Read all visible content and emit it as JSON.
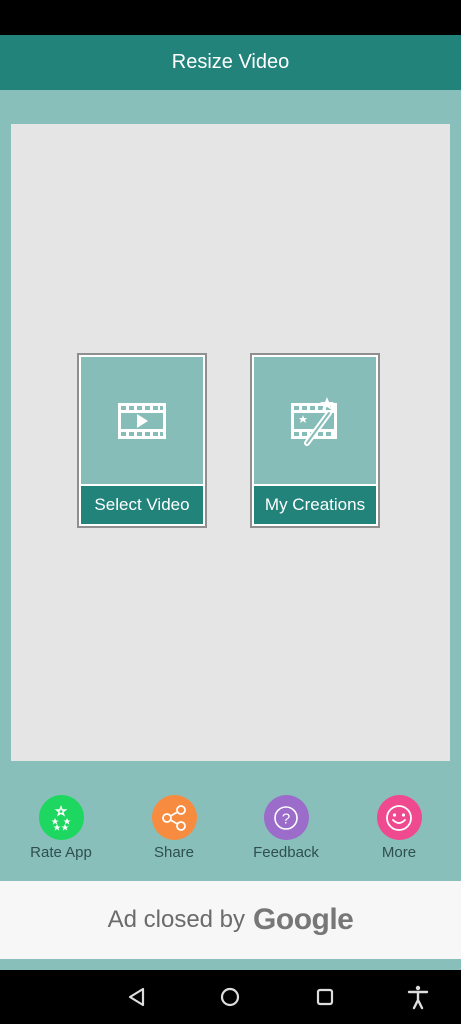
{
  "app_bar": {
    "title": "Resize Video"
  },
  "cards": [
    {
      "label": "Select Video",
      "icon": "film-play-icon"
    },
    {
      "label": "My Creations",
      "icon": "film-magic-wand-icon"
    }
  ],
  "actions": [
    {
      "label": "Rate App",
      "icon": "stars-icon",
      "color": "#1ed760"
    },
    {
      "label": "Share",
      "icon": "share-icon",
      "color": "#f78c40"
    },
    {
      "label": "Feedback",
      "icon": "question-icon",
      "color": "#9b6cc9"
    },
    {
      "label": "More",
      "icon": "smiley-icon",
      "color": "#ef4a8f"
    }
  ],
  "ad": {
    "text": "Ad closed by",
    "brand": "Google"
  },
  "colors": {
    "primary": "#22837b",
    "background": "#88bfbb",
    "panel": "#e5e5e5"
  }
}
